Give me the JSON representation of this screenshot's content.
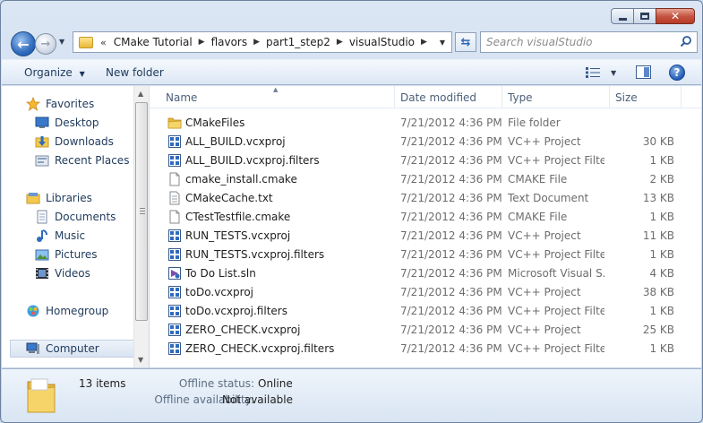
{
  "window": {
    "caption": {
      "minimize": "minimize",
      "maximize": "maximize",
      "close": "✕"
    }
  },
  "navbar": {
    "recent_glyph": "▼",
    "overflow": "«",
    "breadcrumbs": [
      "CMake Tutorial",
      "flavors",
      "part1_step2",
      "visualStudio"
    ],
    "search_placeholder": "Search visualStudio"
  },
  "commandbar": {
    "organize": "Organize",
    "new_folder": "New folder",
    "dropdown_glyph": "▼"
  },
  "navpane": {
    "favorites": {
      "label": "Favorites",
      "items": [
        "Desktop",
        "Downloads",
        "Recent Places"
      ]
    },
    "libraries": {
      "label": "Libraries",
      "items": [
        "Documents",
        "Music",
        "Pictures",
        "Videos"
      ]
    },
    "homegroup": "Homegroup",
    "computer": "Computer"
  },
  "columns": {
    "name": "Name",
    "date": "Date modified",
    "type": "Type",
    "size": "Size"
  },
  "files": [
    {
      "name": "CMakeFiles",
      "date": "7/21/2012 4:36 PM",
      "type": "File folder",
      "size": "",
      "icon": "folder-icon"
    },
    {
      "name": "ALL_BUILD.vcxproj",
      "date": "7/21/2012 4:36 PM",
      "type": "VC++ Project",
      "size": "30 KB",
      "icon": "vcxproj-icon"
    },
    {
      "name": "ALL_BUILD.vcxproj.filters",
      "date": "7/21/2012 4:36 PM",
      "type": "VC++ Project Filte...",
      "size": "1 KB",
      "icon": "vcxproj-icon"
    },
    {
      "name": "cmake_install.cmake",
      "date": "7/21/2012 4:36 PM",
      "type": "CMAKE File",
      "size": "2 KB",
      "icon": "blank-file-icon"
    },
    {
      "name": "CMakeCache.txt",
      "date": "7/21/2012 4:36 PM",
      "type": "Text Document",
      "size": "13 KB",
      "icon": "text-file-icon"
    },
    {
      "name": "CTestTestfile.cmake",
      "date": "7/21/2012 4:36 PM",
      "type": "CMAKE File",
      "size": "1 KB",
      "icon": "blank-file-icon"
    },
    {
      "name": "RUN_TESTS.vcxproj",
      "date": "7/21/2012 4:36 PM",
      "type": "VC++ Project",
      "size": "11 KB",
      "icon": "vcxproj-icon"
    },
    {
      "name": "RUN_TESTS.vcxproj.filters",
      "date": "7/21/2012 4:36 PM",
      "type": "VC++ Project Filte...",
      "size": "1 KB",
      "icon": "vcxproj-icon"
    },
    {
      "name": "To Do List.sln",
      "date": "7/21/2012 4:36 PM",
      "type": "Microsoft Visual S...",
      "size": "4 KB",
      "icon": "solution-icon"
    },
    {
      "name": "toDo.vcxproj",
      "date": "7/21/2012 4:36 PM",
      "type": "VC++ Project",
      "size": "38 KB",
      "icon": "vcxproj-icon"
    },
    {
      "name": "toDo.vcxproj.filters",
      "date": "7/21/2012 4:36 PM",
      "type": "VC++ Project Filte...",
      "size": "1 KB",
      "icon": "vcxproj-icon"
    },
    {
      "name": "ZERO_CHECK.vcxproj",
      "date": "7/21/2012 4:36 PM",
      "type": "VC++ Project",
      "size": "25 KB",
      "icon": "vcxproj-icon"
    },
    {
      "name": "ZERO_CHECK.vcxproj.filters",
      "date": "7/21/2012 4:36 PM",
      "type": "VC++ Project Filte...",
      "size": "1 KB",
      "icon": "vcxproj-icon"
    }
  ],
  "details": {
    "count": "13 items",
    "offline_status_label": "Offline status:",
    "offline_status_value": "Online",
    "offline_availability_label": "Offline availability:",
    "offline_availability_value": "Not available"
  },
  "colors": {
    "accent": "#2f6bbd",
    "folder": "#f2c94c",
    "window_frame": "#c3d4ea"
  }
}
